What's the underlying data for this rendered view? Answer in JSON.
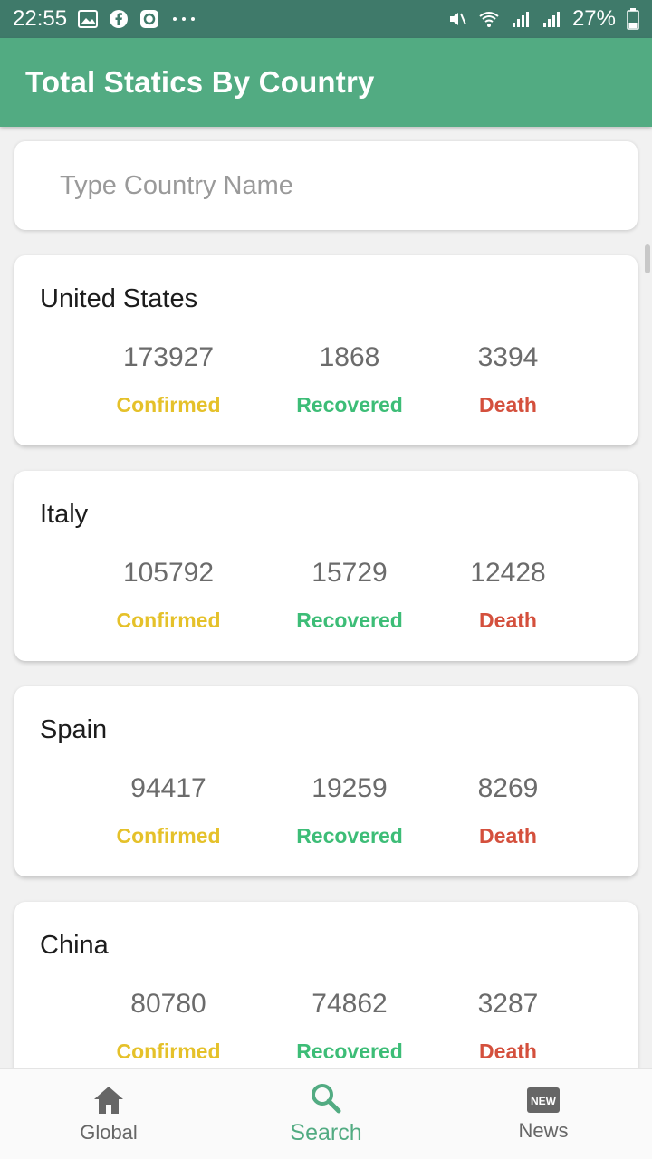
{
  "status_bar": {
    "time": "22:55",
    "battery": "27%"
  },
  "app_bar": {
    "title": "Total Statics By Country"
  },
  "search": {
    "placeholder": "Type Country Name"
  },
  "colors": {
    "confirmed": "#e5c12a",
    "recovered": "#3dbd77",
    "death": "#d4503d",
    "accent": "#52ab82"
  },
  "countries": [
    {
      "name": "United States",
      "confirmed": "173927",
      "recovered": "1868",
      "death": "3394",
      "labels": {
        "confirmed": "Confirmed",
        "recovered": "Recovered",
        "death": "Death"
      }
    },
    {
      "name": "Italy",
      "confirmed": "105792",
      "recovered": "15729",
      "death": "12428",
      "labels": {
        "confirmed": "Confirmed",
        "recovered": "Recovered",
        "death": "Death"
      }
    },
    {
      "name": "Spain",
      "confirmed": "94417",
      "recovered": "19259",
      "death": "8269",
      "labels": {
        "confirmed": "Confirmed",
        "recovered": "Recovered",
        "death": "Death"
      }
    },
    {
      "name": "China",
      "confirmed": "80780",
      "recovered": "74862",
      "death": "3287",
      "labels": {
        "confirmed": "Confirmed",
        "recovered": "Recovered",
        "death": "Death"
      }
    }
  ],
  "bottom_nav": {
    "items": [
      {
        "label": "Global",
        "icon": "home-icon",
        "active": false
      },
      {
        "label": "Search",
        "icon": "search-icon",
        "active": true
      },
      {
        "label": "News",
        "icon": "news-icon",
        "active": false
      }
    ]
  }
}
